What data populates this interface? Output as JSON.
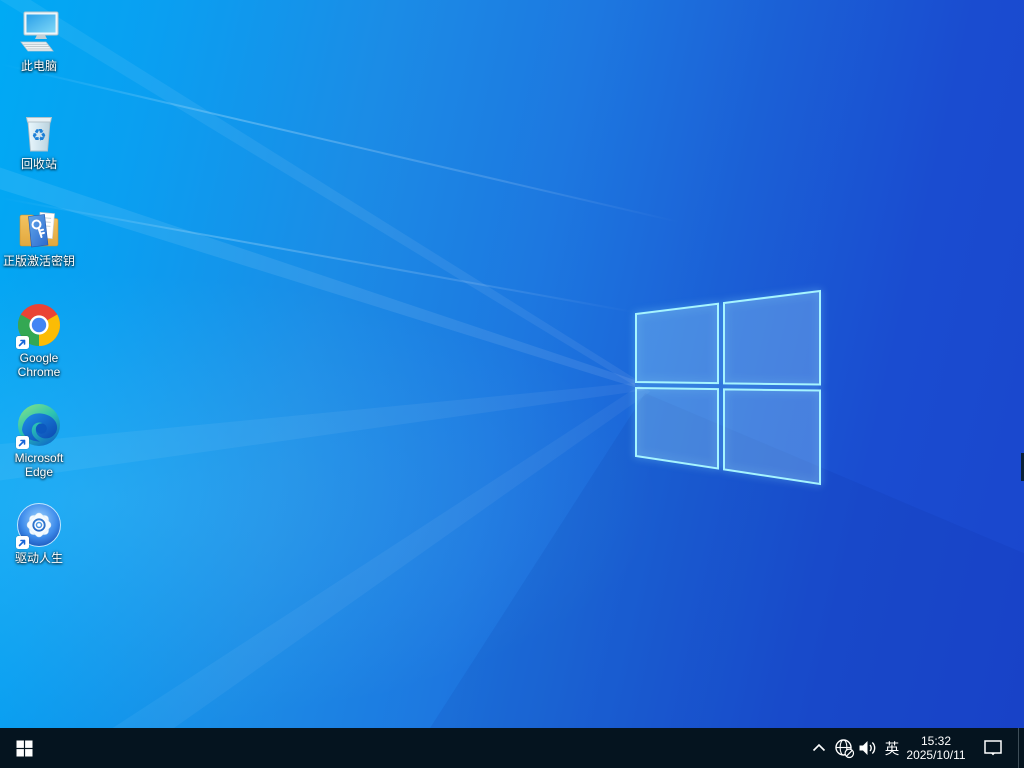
{
  "wallpaper": {
    "name": "windows-10-default-light-rays",
    "colors": {
      "top_right": "#1a46cd",
      "bottom_right": "#1c50cd",
      "mid": "#1d78e0",
      "bottom_left": "#00aaf4",
      "logo_stroke": "#a6f4ff"
    }
  },
  "desktop": {
    "icons": [
      {
        "name": "this-pc",
        "label": "此电脑",
        "shortcut": false
      },
      {
        "name": "recycle-bin",
        "label": "回收站",
        "shortcut": false
      },
      {
        "name": "activation-key-folder",
        "label": "正版激活密钥",
        "shortcut": false
      },
      {
        "name": "google-chrome",
        "label": "Google Chrome",
        "shortcut": true
      },
      {
        "name": "microsoft-edge",
        "label": "Microsoft Edge",
        "shortcut": true
      },
      {
        "name": "driver-life",
        "label": "驱动人生",
        "shortcut": true
      }
    ]
  },
  "taskbar": {
    "background": "#05141f",
    "tray": {
      "icons": [
        "chevron-up",
        "network-globe-offline",
        "volume",
        "action-center"
      ],
      "ime_label": "英",
      "time": "15:32",
      "date": "2025/10/11"
    }
  }
}
